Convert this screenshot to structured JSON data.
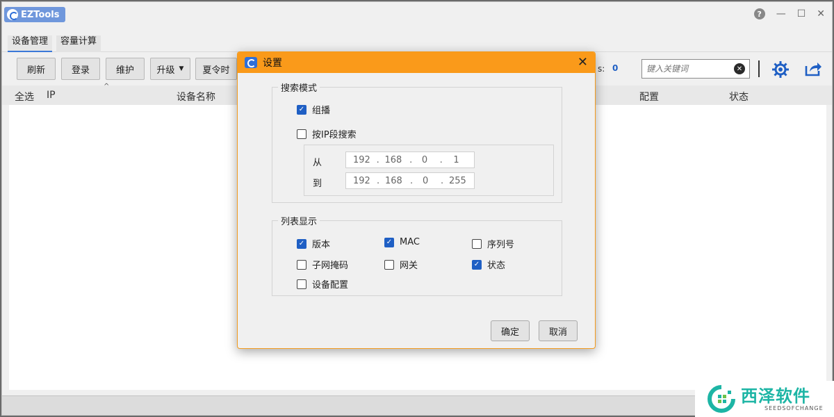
{
  "app": {
    "title": "EZTools"
  },
  "tabs": [
    {
      "label": "设备管理",
      "active": true
    },
    {
      "label": "容量计算",
      "active": false
    }
  ],
  "toolbar": {
    "refresh": "刷新",
    "login": "登录",
    "maintain": "维护",
    "upgrade": "升级",
    "dst": "夏令时",
    "count_label": "s:",
    "count_value": "0",
    "search_placeholder": "键入关键词"
  },
  "table": {
    "select_all": "全选",
    "columns": [
      "IP",
      "设备名称",
      "配置",
      "状态"
    ]
  },
  "dialog": {
    "title": "设置",
    "search_mode": {
      "title": "搜索模式",
      "multicast": {
        "label": "组播",
        "checked": true
      },
      "ip_range": {
        "label": "按IP段搜索",
        "checked": false
      },
      "from_label": "从",
      "to_label": "到",
      "from_ip": [
        "192",
        "168",
        "0",
        "1"
      ],
      "to_ip": [
        "192",
        "168",
        "0",
        "255"
      ]
    },
    "list_display": {
      "title": "列表显示",
      "options": [
        {
          "label": "版本",
          "checked": true
        },
        {
          "label": "MAC",
          "checked": true
        },
        {
          "label": "序列号",
          "checked": false
        },
        {
          "label": "子网掩码",
          "checked": false
        },
        {
          "label": "网关",
          "checked": false
        },
        {
          "label": "状态",
          "checked": true
        },
        {
          "label": "设备配置",
          "checked": false
        }
      ]
    },
    "ok": "确定",
    "cancel": "取消"
  },
  "watermark": {
    "cn": "西泽软件",
    "en": "SEEDSOFCHANGE"
  },
  "colors": {
    "accent": "#1f5fc4",
    "dialog_title": "#fa9a1a",
    "watermark": "#1db5a5"
  }
}
